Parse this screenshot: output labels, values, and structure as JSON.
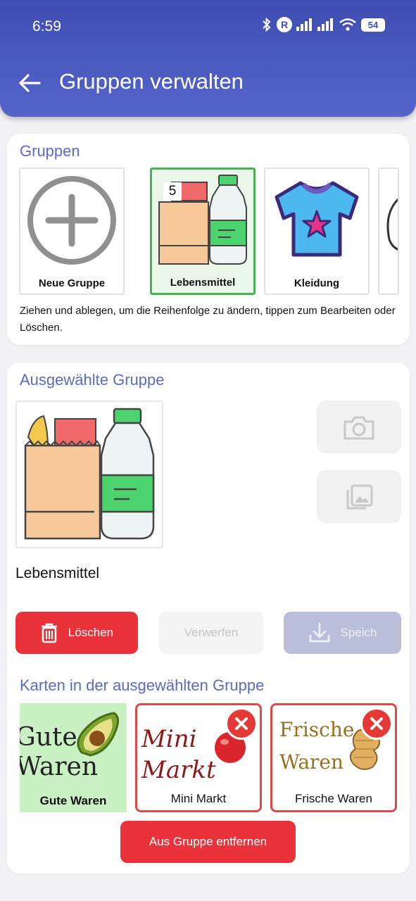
{
  "status": {
    "time": "6:59",
    "carrier_badge": "R",
    "battery": "54"
  },
  "header": {
    "title": "Gruppen verwalten",
    "back_icon": "arrow-left-icon"
  },
  "groups": {
    "title": "Gruppen",
    "items": [
      {
        "label": "Neue Gruppe",
        "icon": "plus-circle-icon"
      },
      {
        "label": "Lebensmittel",
        "icon": "groceries-icon",
        "count": "5",
        "selected": true
      },
      {
        "label": "Kleidung",
        "icon": "tshirt-icon"
      }
    ],
    "hint": "Ziehen und ablegen, um die Reihenfolge zu ändern, tippen zum Bearbeiten oder Löschen."
  },
  "selected": {
    "title": "Ausgewählte Gruppe",
    "name": "Lebensmittel",
    "camera_icon": "camera-icon",
    "gallery_icon": "gallery-icon",
    "delete_label": "Löschen",
    "discard_label": "Verwerfen",
    "save_label": "Speich"
  },
  "cards": {
    "title": "Karten in der ausgewählten Gruppe",
    "items": [
      {
        "label": "Gute Waren",
        "art_line1": "Gute",
        "art_line2": "Waren"
      },
      {
        "label": "Mini Markt",
        "art_line1": "Mini",
        "art_line2": "Markt"
      },
      {
        "label": "Frische Waren",
        "art_line1": "Frische",
        "art_line2": "Waren"
      }
    ],
    "remove_label": "Aus Gruppe entfernen"
  },
  "colors": {
    "accent": "#4251b5",
    "section_title": "#5b6bc3",
    "danger": "#e9323a",
    "selected_border": "#45b354"
  }
}
